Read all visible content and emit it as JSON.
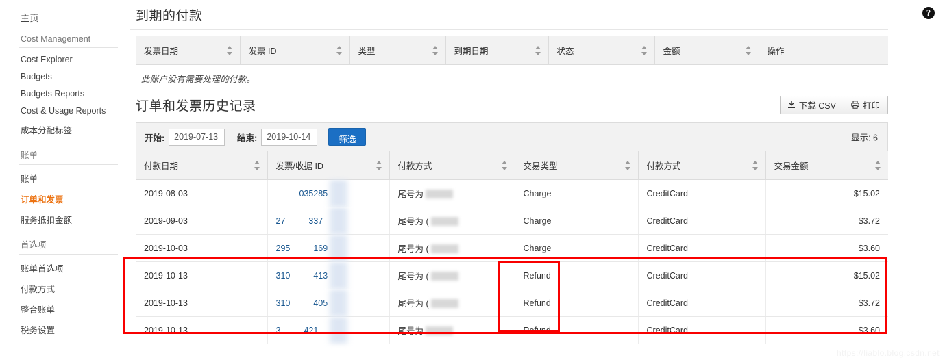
{
  "sidebar": {
    "home_label": "主页",
    "sections": [
      {
        "title": "Cost Management",
        "items": [
          {
            "label": "Cost Explorer",
            "active": false
          },
          {
            "label": "Budgets",
            "active": false
          },
          {
            "label": "Budgets Reports",
            "active": false
          },
          {
            "label": "Cost & Usage Reports",
            "active": false
          },
          {
            "label": "成本分配标签",
            "active": false
          }
        ]
      },
      {
        "title": "账单",
        "items": [
          {
            "label": "账单",
            "active": false
          },
          {
            "label": "订单和发票",
            "active": true
          },
          {
            "label": "服务抵扣金额",
            "active": false
          }
        ]
      },
      {
        "title": "首选项",
        "items": [
          {
            "label": "账单首选项",
            "active": false
          },
          {
            "label": "付款方式",
            "active": false
          },
          {
            "label": "整合账单",
            "active": false
          },
          {
            "label": "税务设置",
            "active": false
          }
        ]
      }
    ]
  },
  "due_payments": {
    "title": "到期的付款",
    "help_icon": "help-circle-icon",
    "columns": [
      "发票日期",
      "发票 ID",
      "类型",
      "到期日期",
      "状态",
      "金额",
      "操作"
    ],
    "empty_message": "此账户没有需要处理的付款。"
  },
  "history": {
    "title": "订单和发票历史记录",
    "download_csv_label": "下载 CSV",
    "download_csv_icon": "download-icon",
    "print_label": "打印",
    "print_icon": "printer-icon",
    "filter": {
      "start_label": "开始:",
      "start_value": "2019-07-13",
      "end_label": "结束:",
      "end_value": "2019-10-14",
      "button_label": "筛选",
      "show_count_label": "显示: 6"
    },
    "columns": [
      "付款日期",
      "发票/收据 ID",
      "付款方式",
      "交易类型",
      "付款方式",
      "交易金额"
    ],
    "rows": [
      {
        "date": "2019-08-03",
        "id_prefix": "",
        "id_suffix": "035285",
        "payment_method": "尾号为",
        "txn_type": "Charge",
        "method": "CreditCard",
        "amount": "$15.02",
        "highlighted": false
      },
      {
        "date": "2019-09-03",
        "id_prefix": "27",
        "id_suffix": "337",
        "payment_method": "尾号为 (",
        "txn_type": "Charge",
        "method": "CreditCard",
        "amount": "$3.72",
        "highlighted": false
      },
      {
        "date": "2019-10-03",
        "id_prefix": "295",
        "id_suffix": "169",
        "payment_method": "尾号为 (",
        "txn_type": "Charge",
        "method": "CreditCard",
        "amount": "$3.60",
        "highlighted": false
      },
      {
        "date": "2019-10-13",
        "id_prefix": "310",
        "id_suffix": "413",
        "payment_method": "尾号为 (",
        "txn_type": "Refund",
        "method": "CreditCard",
        "amount": "$15.02",
        "highlighted": true
      },
      {
        "date": "2019-10-13",
        "id_prefix": "310",
        "id_suffix": "405",
        "payment_method": "尾号为 (",
        "txn_type": "Refund",
        "method": "CreditCard",
        "amount": "$3.72",
        "highlighted": true
      },
      {
        "date": "2019-10-13",
        "id_prefix": "3",
        "id_suffix": "421",
        "payment_method": "尾号为",
        "txn_type": "Refund",
        "method": "CreditCard",
        "amount": "$3.60",
        "highlighted": true
      }
    ]
  },
  "watermark": "https://liablo.blog.csdn.net",
  "colors": {
    "accent": "#ec7211",
    "link": "#16558f",
    "filter_button": "#1b6fc4",
    "annotation": "#f90000",
    "header_bg": "#f2f2f2"
  }
}
